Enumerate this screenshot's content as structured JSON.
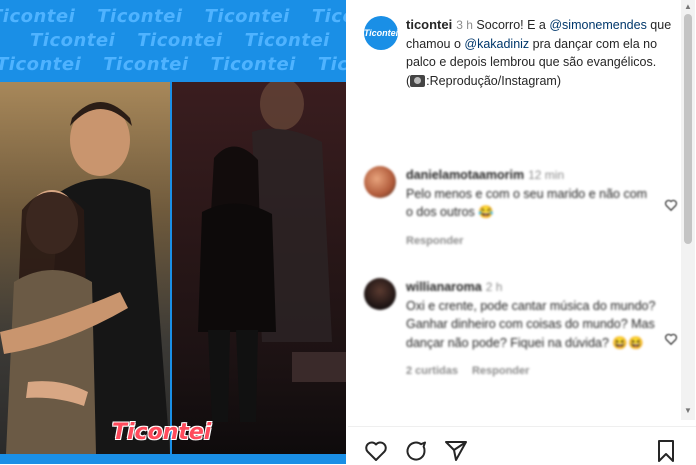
{
  "media": {
    "pattern_text": "Ticontei",
    "stamp_text": "Ticontei"
  },
  "post": {
    "avatar_text": "Ticontei",
    "username": "ticontei",
    "time": "3 h",
    "caption_part1": "Socorro! E a ",
    "mention1": "@simonemendes",
    "caption_part2": " que chamou o ",
    "mention2": "@kakadiniz",
    "caption_part3": " pra dançar com ela no palco e depois lembrou que são evangélicos.",
    "credit": "Reprodução/Instagram"
  },
  "comments": [
    {
      "username": "danielamotaamorim",
      "time": "12 min",
      "text": "Pelo menos e com o seu marido e não com o dos outros 😂",
      "reply_label": "Responder"
    },
    {
      "username": "willianaroma",
      "time": "2 h",
      "text": "Oxi e crente, pode cantar música do mundo? Ganhar dinheiro com coisas do mundo? Mas dançar não pode? Fiquei na dúvida? 😆😆",
      "likes_label": "2 curtidas",
      "reply_label": "Responder"
    }
  ],
  "icons": {
    "like": "heart-icon",
    "comment": "comment-icon",
    "share": "share-icon",
    "save": "bookmark-icon"
  },
  "colors": {
    "brand_blue": "#1a8fe6",
    "stamp_red": "#ff4b5c",
    "mention": "#00376b"
  }
}
